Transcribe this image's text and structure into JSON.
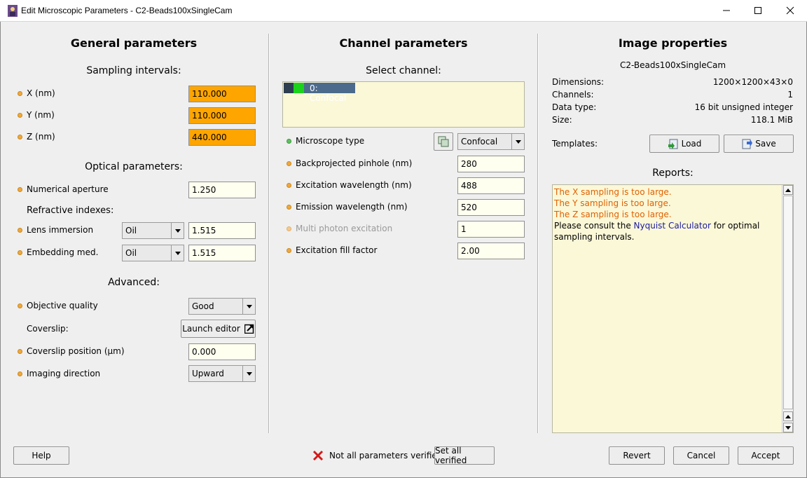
{
  "window": {
    "title": "Edit Microscopic Parameters - C2-Beads100xSingleCam",
    "minimize_icon": "minimize-icon",
    "maximize_icon": "maximize-icon",
    "close_icon": "close-icon"
  },
  "general": {
    "heading": "General parameters",
    "sampling_heading": "Sampling intervals:",
    "x_label": "X (nm)",
    "x_value": "110.000",
    "y_label": "Y (nm)",
    "y_value": "110.000",
    "z_label": "Z (nm)",
    "z_value": "440.000",
    "optical_heading": "Optical parameters:",
    "na_label": "Numerical aperture",
    "na_value": "1.250",
    "refr_heading": "Refractive indexes:",
    "lens_label": "Lens immersion",
    "lens_medium": "Oil",
    "lens_value": "1.515",
    "embed_label": "Embedding med.",
    "embed_medium": "Oil",
    "embed_value": "1.515",
    "advanced_heading": "Advanced:",
    "objective_label": "Objective quality",
    "objective_value": "Good",
    "coverslip_label": "Coverslip:",
    "launch_editor": "Launch editor",
    "coverslip_pos_label": "Coverslip position (µm)",
    "coverslip_pos_value": "0.000",
    "imaging_label": "Imaging direction",
    "imaging_value": "Upward"
  },
  "channel": {
    "heading": "Channel parameters",
    "select_heading": "Select channel:",
    "channels": [
      "0: Confocal"
    ],
    "microscope_label": "Microscope type",
    "microscope_value": "Confocal",
    "pinhole_label": "Backprojected pinhole (nm)",
    "pinhole_value": "280",
    "excitation_label": "Excitation wavelength (nm)",
    "excitation_value": "488",
    "emission_label": "Emission wavelength (nm)",
    "emission_value": "520",
    "multiphoton_label": "Multi photon excitation",
    "multiphoton_value": "1",
    "fill_label": "Excitation fill factor",
    "fill_value": "2.00"
  },
  "image": {
    "heading": "Image properties",
    "name": "C2-Beads100xSingleCam",
    "dimensions_label": "Dimensions:",
    "dimensions_value": "1200×1200×43×0",
    "channels_label": "Channels:",
    "channels_value": "1",
    "datatype_label": "Data type:",
    "datatype_value": "16 bit unsigned integer",
    "size_label": "Size:",
    "size_value": "118.1 MiB",
    "templates_label": "Templates:",
    "load_label": "Load",
    "save_label": "Save",
    "reports_heading": "Reports:",
    "reports": {
      "warn1": "The X sampling is too large.",
      "warn2": "The Y sampling is too large.",
      "warn3": "The Z sampling is too large.",
      "consult_pre": "Please consult the ",
      "consult_link": "Nyquist Calculator",
      "consult_post": " for optimal sampling intervals."
    }
  },
  "footer": {
    "help": "Help",
    "status": "Not all parameters verified",
    "set_all": "Set all verified",
    "revert": "Revert",
    "cancel": "Cancel",
    "accept": "Accept"
  },
  "colors": {
    "unverified_field": "#ffa500",
    "warning_text": "#e06000",
    "link_text": "#1a1aa0",
    "status_dot": "#f0a83c",
    "verified_dot": "#60c060"
  }
}
